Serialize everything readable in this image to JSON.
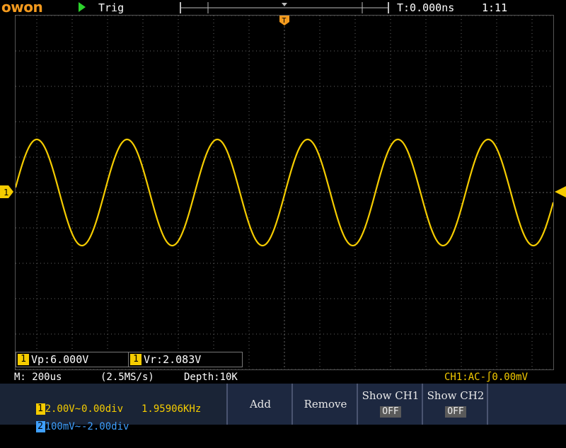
{
  "top": {
    "brand": "owon",
    "trig_state": "Trig",
    "time_position": "T:0.000ns",
    "clock": "1:11"
  },
  "colors": {
    "ch1": "#f5cc00",
    "ch2": "#3fa0ff",
    "brand": "#f39a1e",
    "run": "#2cd32c",
    "grid": "#666666",
    "trigger": "#f39a1e"
  },
  "waveform": {
    "channel": "CH1",
    "frequency_khz": 1.95906,
    "timebase_us_per_div": 200,
    "volts_per_div": 2.0,
    "offset_div": 0.0,
    "peak_to_peak_v": 6.0,
    "amplitude_div": 1.5,
    "horizontal_divisions": 15.2
  },
  "measurements": [
    {
      "channel": "1",
      "text": "Vp:6.000V"
    },
    {
      "channel": "1",
      "text": "Vr:2.083V"
    }
  ],
  "status": {
    "timebase": "M: 200us",
    "sample_rate": "(2.5MS/s)",
    "depth": "Depth:10K",
    "ch1_trigger": "CH1:AC-∫0.00mV"
  },
  "channels": [
    {
      "num": "1",
      "scale": "2.00V~",
      "offset": "0.00div",
      "freq": "1.95906KHz"
    },
    {
      "num": "2",
      "scale": "100mV~",
      "offset": "-2.00div",
      "freq": ""
    }
  ],
  "menu": {
    "add": "Add",
    "remove": "Remove",
    "show_ch1": {
      "label": "Show CH1",
      "value": "OFF"
    },
    "show_ch2": {
      "label": "Show CH2",
      "value": "OFF"
    }
  }
}
